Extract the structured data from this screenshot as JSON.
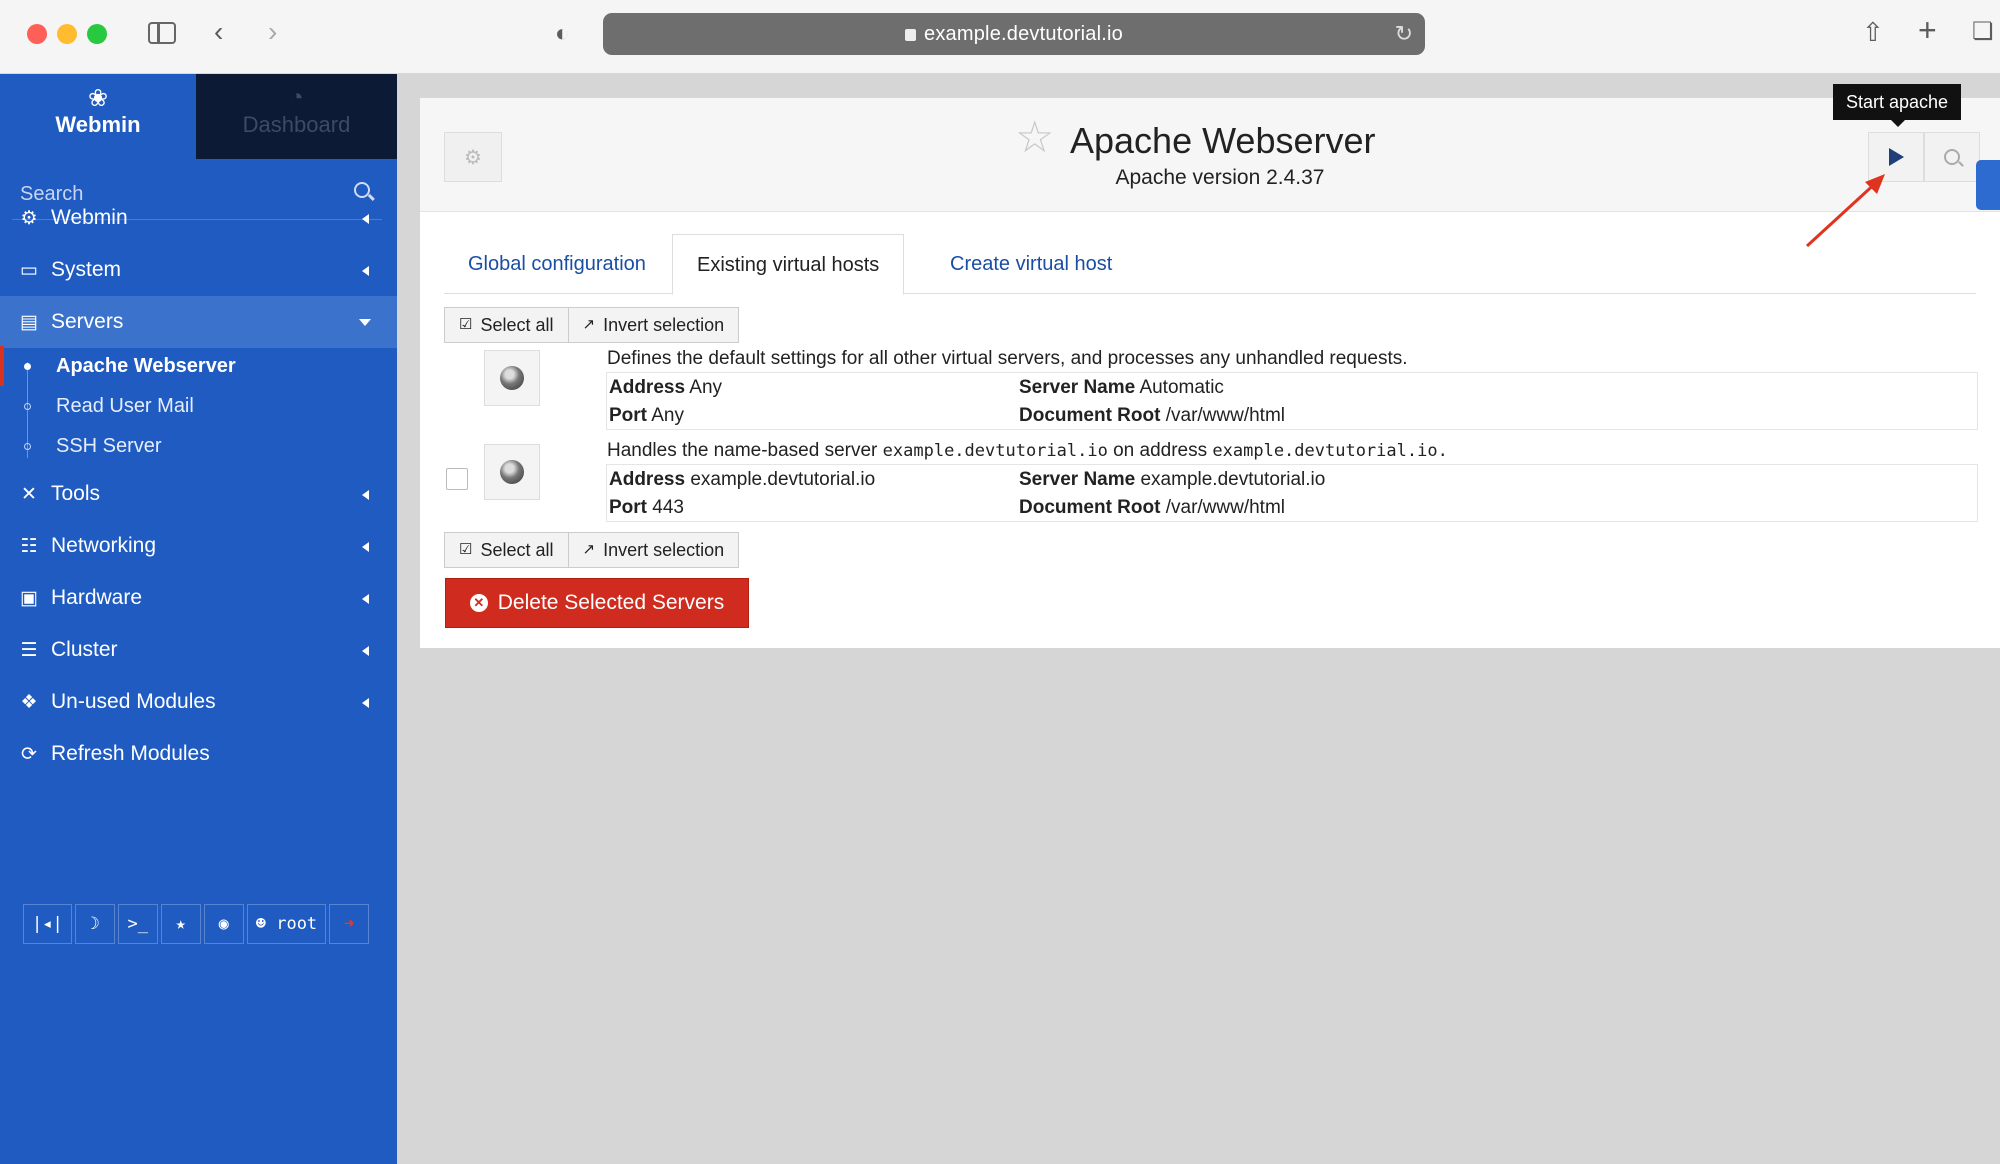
{
  "browser": {
    "url": "example.devtutorial.io"
  },
  "sidebar": {
    "brand": "Webmin",
    "dashboard": "Dashboard",
    "search_placeholder": "Search",
    "items": [
      {
        "label": "Webmin"
      },
      {
        "label": "System"
      },
      {
        "label": "Servers"
      },
      {
        "label": "Tools"
      },
      {
        "label": "Networking"
      },
      {
        "label": "Hardware"
      },
      {
        "label": "Cluster"
      },
      {
        "label": "Un-used Modules"
      },
      {
        "label": "Refresh Modules"
      }
    ],
    "sub_items": [
      {
        "label": "Apache Webserver"
      },
      {
        "label": "Read User Mail"
      },
      {
        "label": "SSH Server"
      }
    ],
    "bottom_user": "root"
  },
  "header": {
    "title": "Apache Webserver",
    "subtitle": "Apache version 2.4.37",
    "tooltip": "Start apache"
  },
  "tabs": [
    {
      "label": "Global configuration"
    },
    {
      "label": "Existing virtual hosts"
    },
    {
      "label": "Create virtual host"
    }
  ],
  "actions": {
    "select_all": "Select all",
    "invert_selection": "Invert selection",
    "delete": "Delete Selected Servers"
  },
  "vhosts": [
    {
      "description": "Defines the default settings for all other virtual servers, and processes any unhandled requests.",
      "address_label": "Address",
      "address": "Any",
      "port_label": "Port",
      "port": "Any",
      "server_name_label": "Server Name",
      "server_name": "Automatic",
      "docroot_label": "Document Root",
      "docroot": "/var/www/html"
    },
    {
      "description_prefix": "Handles the name-based server",
      "description_server": "example.devtutorial.io",
      "description_mid": "on address",
      "description_address": "example.devtutorial.io.",
      "address_label": "Address",
      "address": "example.devtutorial.io",
      "port_label": "Port",
      "port": "443",
      "server_name_label": "Server Name",
      "server_name": "example.devtutorial.io",
      "docroot_label": "Document Root",
      "docroot": "/var/www/html"
    }
  ]
}
